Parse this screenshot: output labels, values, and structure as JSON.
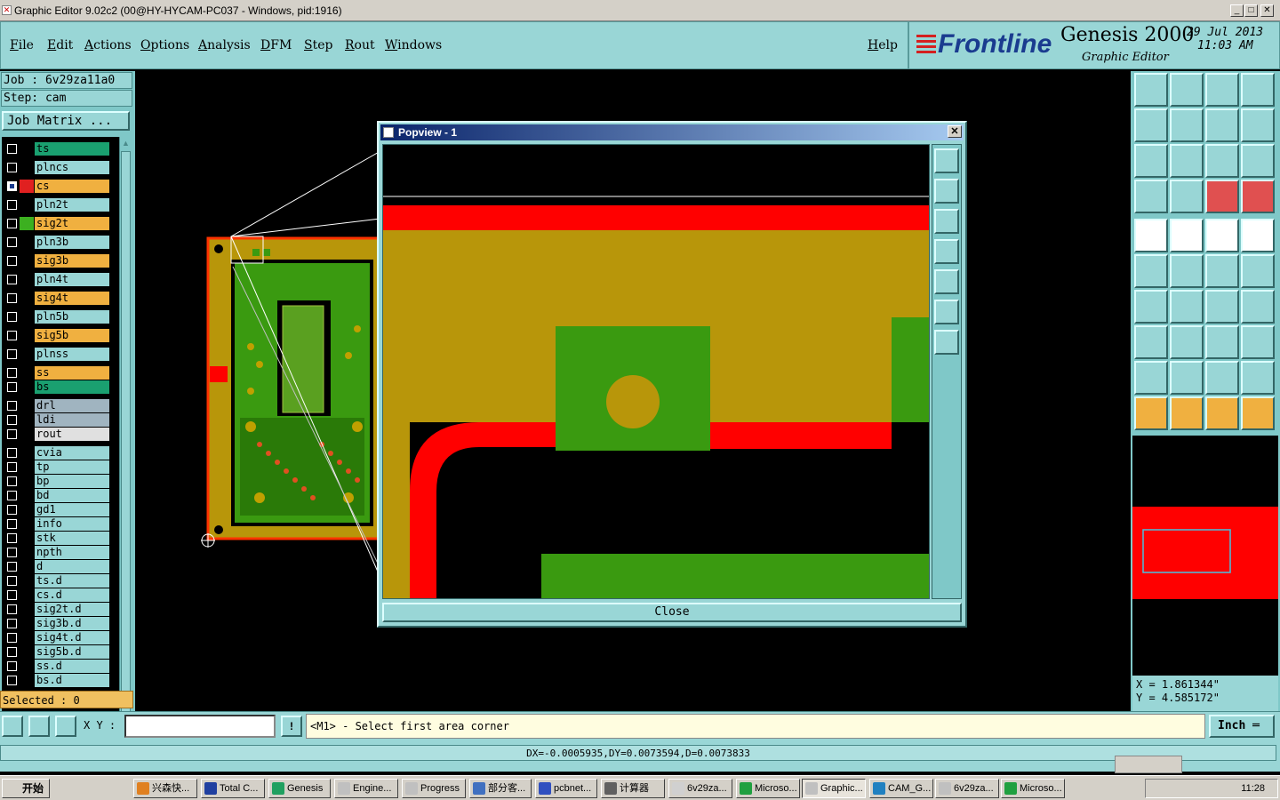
{
  "window": {
    "title": "Graphic Editor 9.02c2 (00@HY-HYCAM-PC037 - Windows, pid:1916)",
    "minimize": "_",
    "maximize": "□",
    "close": "✕"
  },
  "menu": [
    "File",
    "Edit",
    "Actions",
    "Options",
    "Analysis",
    "DFM",
    "Step",
    "Rout",
    "Windows"
  ],
  "help": "Help",
  "brand": {
    "logo": "Frontline",
    "product": "Genesis 2000",
    "subtitle": "Graphic Editor",
    "date": "29 Jul 2013",
    "time": "11:03 AM"
  },
  "job": {
    "job_label": "Job : 6v29za11a0",
    "step_label": "Step: cam",
    "matrix_button": "Job Matrix ..."
  },
  "layers": [
    {
      "name": "ts",
      "color": "#1aa070",
      "swatch": "#000",
      "checked": false
    },
    {
      "name": "plncs",
      "color": "#99d6d6",
      "swatch": "#000",
      "checked": false
    },
    {
      "name": "cs",
      "color": "#f0b040",
      "swatch": "#e02020",
      "checked": true
    },
    {
      "name": "pln2t",
      "color": "#99d6d6",
      "swatch": "#000",
      "checked": false
    },
    {
      "name": "sig2t",
      "color": "#f0b040",
      "swatch": "#3cb020",
      "checked": false
    },
    {
      "name": "pln3b",
      "color": "#99d6d6",
      "swatch": "#000",
      "checked": false
    },
    {
      "name": "sig3b",
      "color": "#f0b040",
      "swatch": "#000",
      "checked": false
    },
    {
      "name": "pln4t",
      "color": "#99d6d6",
      "swatch": "#000",
      "checked": false
    },
    {
      "name": "sig4t",
      "color": "#f0b040",
      "swatch": "#000",
      "checked": false
    },
    {
      "name": "pln5b",
      "color": "#99d6d6",
      "swatch": "#000",
      "checked": false
    },
    {
      "name": "sig5b",
      "color": "#f0b040",
      "swatch": "#000",
      "checked": false
    },
    {
      "name": "plnss",
      "color": "#99d6d6",
      "swatch": "#000",
      "checked": false
    },
    {
      "name": "ss",
      "color": "#f0b040",
      "swatch": "#000",
      "checked": false
    },
    {
      "name": "bs",
      "color": "#1aa070",
      "swatch": "#000",
      "checked": false
    },
    {
      "name": "drl",
      "color": "#a0b4c0",
      "swatch": "#000",
      "checked": false
    },
    {
      "name": "ldi",
      "color": "#a0b4c0",
      "swatch": "#000",
      "checked": false
    },
    {
      "name": "rout",
      "color": "#e0e0e0",
      "swatch": "#000",
      "checked": false
    },
    {
      "name": "cvia",
      "color": "#99d6d6",
      "swatch": "#000",
      "checked": false
    },
    {
      "name": "tp",
      "color": "#99d6d6",
      "swatch": "#000",
      "checked": false
    },
    {
      "name": "bp",
      "color": "#99d6d6",
      "swatch": "#000",
      "checked": false
    },
    {
      "name": "bd",
      "color": "#99d6d6",
      "swatch": "#000",
      "checked": false
    },
    {
      "name": "gd1",
      "color": "#99d6d6",
      "swatch": "#000",
      "checked": false
    },
    {
      "name": "info",
      "color": "#99d6d6",
      "swatch": "#000",
      "checked": false
    },
    {
      "name": "stk",
      "color": "#99d6d6",
      "swatch": "#000",
      "checked": false
    },
    {
      "name": "npth",
      "color": "#99d6d6",
      "swatch": "#000",
      "checked": false
    },
    {
      "name": "d",
      "color": "#99d6d6",
      "swatch": "#000",
      "checked": false
    },
    {
      "name": "ts.d",
      "color": "#99d6d6",
      "swatch": "#000",
      "checked": false
    },
    {
      "name": "cs.d",
      "color": "#99d6d6",
      "swatch": "#000",
      "checked": false
    },
    {
      "name": "sig2t.d",
      "color": "#99d6d6",
      "swatch": "#000",
      "checked": false
    },
    {
      "name": "sig3b.d",
      "color": "#99d6d6",
      "swatch": "#000",
      "checked": false
    },
    {
      "name": "sig4t.d",
      "color": "#99d6d6",
      "swatch": "#000",
      "checked": false
    },
    {
      "name": "sig5b.d",
      "color": "#99d6d6",
      "swatch": "#000",
      "checked": false
    },
    {
      "name": "ss.d",
      "color": "#99d6d6",
      "swatch": "#000",
      "checked": false
    },
    {
      "name": "bs.d",
      "color": "#99d6d6",
      "swatch": "#000",
      "checked": false
    }
  ],
  "selected": "Selected : 0",
  "popup": {
    "title": "Popview - 1",
    "close_label": "Close",
    "close_x": "✕"
  },
  "coords": {
    "x": "X = 1.861344\"",
    "y": "Y = 4.585172\""
  },
  "command": {
    "xy_label": "X Y :",
    "xy_value": "",
    "prompt": "<M1> - Select first area corner",
    "unit": "Inch"
  },
  "status": "DX=-0.0005935,DY=0.0073594,D=0.0073833",
  "taskbar": {
    "start": "开始",
    "tasks": [
      "兴森快...",
      "Total C...",
      "Genesis",
      "Engine...",
      "Progress",
      "部分客...",
      "pcbnet...",
      "计算器",
      "6v29za...",
      "Microso...",
      "Graphic...",
      "CAM_G...",
      "6v29za...",
      "Microso..."
    ],
    "clock": "11:28"
  },
  "colors": {
    "accent": "#99d6d6",
    "copper": "#b8960a",
    "red": "#ff0000",
    "green": "#3a9a10"
  }
}
